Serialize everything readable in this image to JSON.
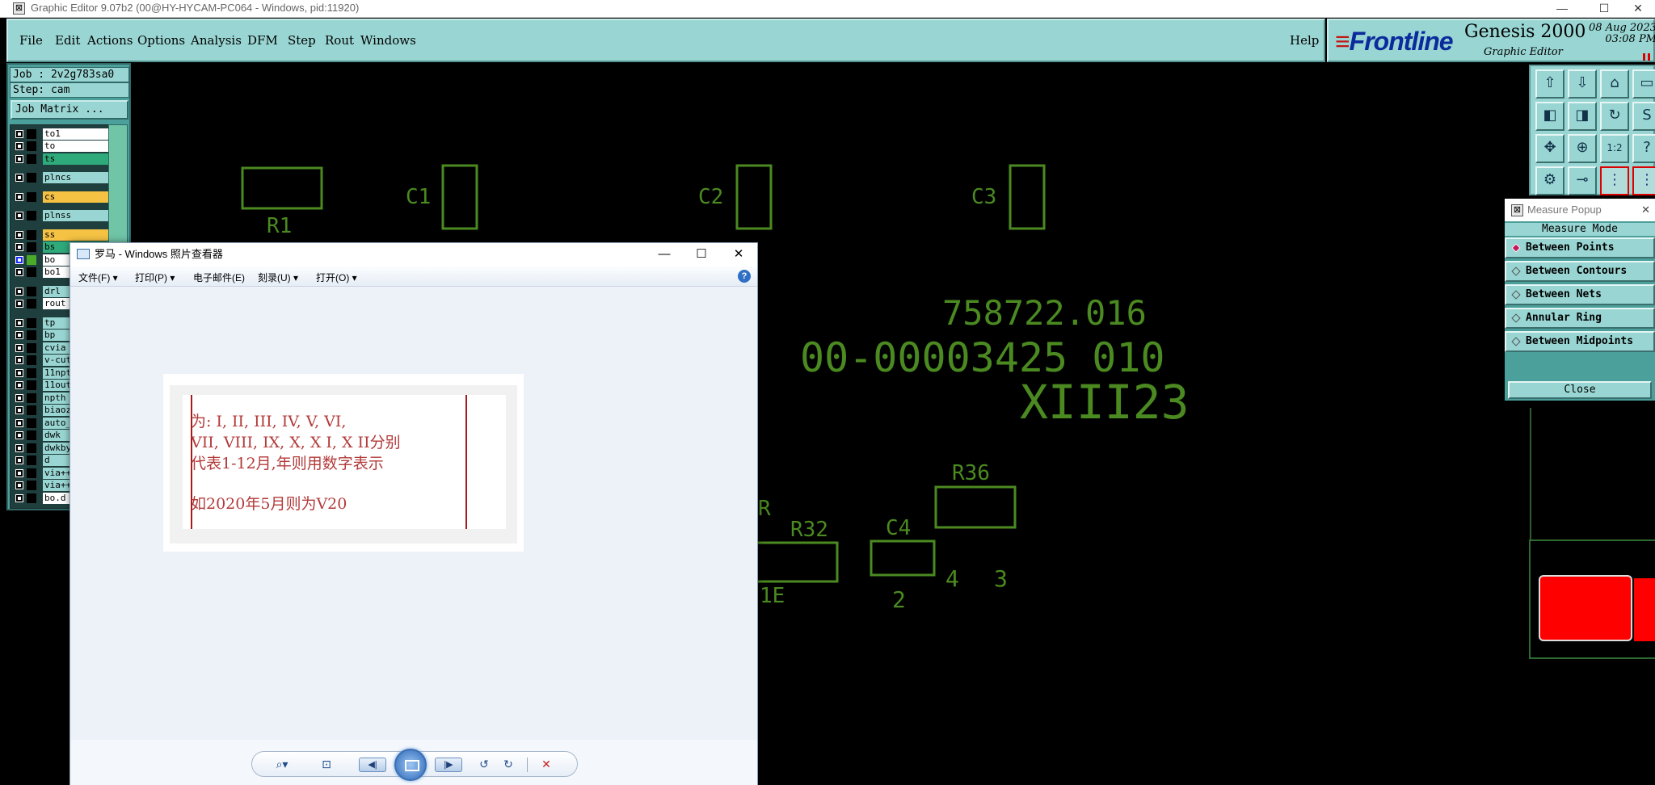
{
  "app": {
    "title": "Graphic Editor 9.07b2 (00@HY-HYCAM-PC064 - Windows, pid:11920)",
    "window_controls": [
      "—",
      "☐",
      "✕"
    ]
  },
  "menu": {
    "items": [
      "File",
      "Edit",
      "Actions",
      "Options",
      "Analysis",
      "DFM",
      "Step",
      "Rout",
      "Windows"
    ],
    "help": "Help"
  },
  "banner": {
    "logo": "Frontline",
    "product": "Genesis 2000",
    "subtitle": "Graphic Editor",
    "date": "08 Aug 2023",
    "time": "03:08 PM"
  },
  "job_panel": {
    "job": "Job : 2v2g783sa0",
    "step": "Step: cam",
    "job_matrix": "Job Matrix ..."
  },
  "layers": [
    {
      "name": "to1",
      "color": "#ffffff"
    },
    {
      "name": "to",
      "color": "#ffffff"
    },
    {
      "name": "ts",
      "color": "#2faa7a"
    },
    {
      "name": "plncs",
      "color": "#99d6d3"
    },
    {
      "name": "cs",
      "color": "#f5c243"
    },
    {
      "name": "plnss",
      "color": "#99d6d3"
    },
    {
      "name": "ss",
      "color": "#f5c243"
    },
    {
      "name": "bs",
      "color": "#2faa7a"
    },
    {
      "name": "bo",
      "color": "#ffffff",
      "swatch": "#4caa2a",
      "checked": true
    },
    {
      "name": "bo1",
      "color": "#ffffff"
    },
    {
      "name": "drl",
      "color": "#99d6d3"
    },
    {
      "name": "rout",
      "color": "#ffffff"
    },
    {
      "name": "tp",
      "color": "#99d6d3"
    },
    {
      "name": "bp",
      "color": "#99d6d3"
    },
    {
      "name": "cvia",
      "color": "#99d6d3"
    },
    {
      "name": "v-cut",
      "color": "#99d6d3"
    },
    {
      "name": "11npt",
      "color": "#99d6d3"
    },
    {
      "name": "11out",
      "color": "#99d6d3"
    },
    {
      "name": "npth",
      "color": "#99d6d3"
    },
    {
      "name": "biaoz",
      "color": "#99d6d3"
    },
    {
      "name": "auto_",
      "color": "#99d6d3"
    },
    {
      "name": "dwk",
      "color": "#99d6d3"
    },
    {
      "name": "dwkby",
      "color": "#99d6d3"
    },
    {
      "name": "d",
      "color": "#99d6d3"
    },
    {
      "name": "via++",
      "color": "#99d6d3"
    },
    {
      "name": "via++",
      "color": "#99d6d3"
    },
    {
      "name": "bo.d",
      "color": "#ffffff"
    }
  ],
  "toolbar_icons": [
    "zoom-home-icon",
    "zoom-fit-icon",
    "home-icon",
    "window-icon",
    "pan-left-icon",
    "pan-right-icon",
    "redraw-icon",
    "snap-icon",
    "zoom-in-icon",
    "zoom-out-icon",
    "scale-1to2-icon",
    "help-icon",
    "settings-icon",
    "measure-icon",
    "net-icon",
    "net2-icon"
  ],
  "toolbar_glyphs": [
    "⇧",
    "⇩",
    "⌂",
    "▭",
    "◧",
    "◨",
    "↻",
    "S",
    "✥",
    "⊕",
    "1:2",
    "?",
    "⚙",
    "⊸",
    "⋮",
    "⋮"
  ],
  "toolbar_labels": {
    "scale": "1:2",
    "help": "?",
    "snap": "S"
  },
  "measure": {
    "title": "Measure Popup",
    "mode_label": "Measure Mode",
    "options": [
      "Between Points",
      "Between Contours",
      "Between Nets",
      "Annular Ring",
      "Between Midpoints"
    ],
    "selected": "Between Points",
    "close": "Close"
  },
  "pcb": {
    "labels": [
      "R1",
      "C1",
      "C2",
      "C3",
      "758722.016",
      "00-00003425 010",
      "XIII23",
      "R36",
      "C4",
      "R32",
      "R",
      "1E",
      "3",
      "4",
      "2"
    ],
    "trace_color": "#4b8a20"
  },
  "viewer": {
    "title": "罗马 - Windows 照片查看器",
    "menu": [
      "文件(F)",
      "打印(P)",
      "电子邮件(E)",
      "刻录(U)",
      "打开(O)"
    ],
    "menu_dropdown": [
      true,
      true,
      false,
      true,
      true
    ],
    "photo_lines": [
      "为:  I,  II,  III,  IV,  V,  VI,",
      "VII,  VIII,  IX,  X,  X I,  X II分别",
      "代表1-12月,年则用数字表示",
      "如2020年5月则为V20"
    ],
    "controls": [
      "zoom-icon",
      "fit-icon",
      "previous-icon",
      "slideshow-icon",
      "next-icon",
      "rotate-left-icon",
      "rotate-right-icon",
      "delete-icon"
    ]
  }
}
